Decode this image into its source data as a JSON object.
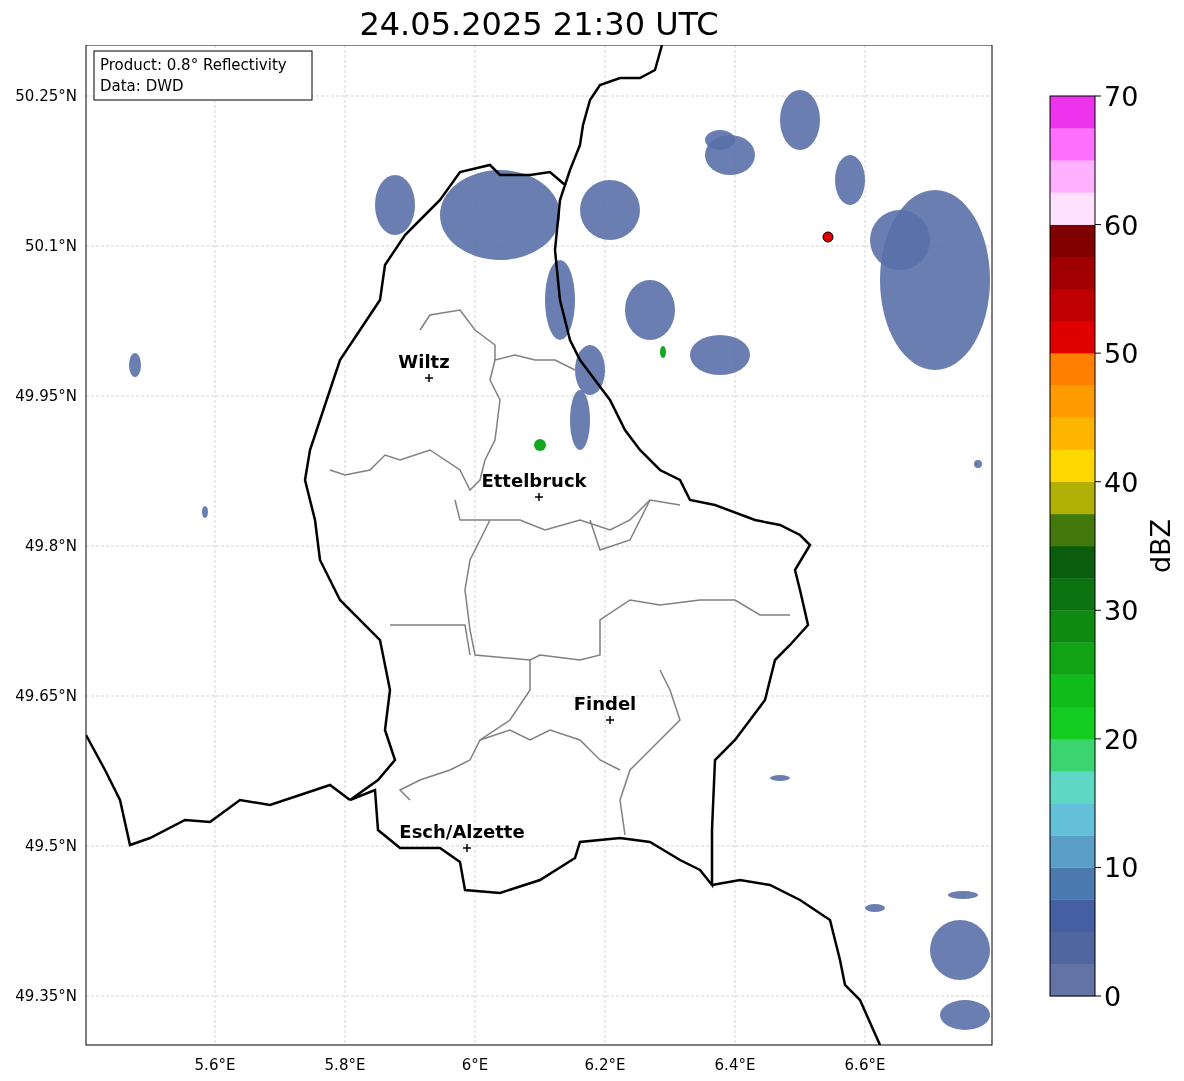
{
  "title": "24.05.2025 21:30 UTC",
  "map": {
    "info_box": [
      "Product: 0.8° Reflectivity",
      "Data: DWD"
    ],
    "lat_ticks": [
      "50.25°N",
      "50.1°N",
      "49.95°N",
      "49.8°N",
      "49.65°N",
      "49.5°N",
      "49.35°N"
    ],
    "lon_ticks": [
      "5.6°E",
      "5.8°E",
      "6°E",
      "6.2°E",
      "6.4°E",
      "6.6°E"
    ],
    "places": [
      {
        "name": "Wiltz"
      },
      {
        "name": "Ettelbruck"
      },
      {
        "name": "Findel"
      },
      {
        "name": "Esch/Alzette"
      }
    ]
  },
  "colorbar": {
    "label": "dBZ",
    "ticks": [
      "70",
      "60",
      "50",
      "40",
      "30",
      "20",
      "10",
      "0"
    ],
    "segments": [
      {
        "color": "#6473a5"
      },
      {
        "color": "#4f66a0"
      },
      {
        "color": "#4460a2"
      },
      {
        "color": "#4a7ab0"
      },
      {
        "color": "#5b9ec8"
      },
      {
        "color": "#63c0d8"
      },
      {
        "color": "#5ed8c4"
      },
      {
        "color": "#3cd46f"
      },
      {
        "color": "#13cc1f"
      },
      {
        "color": "#10bc1a"
      },
      {
        "color": "#10a414"
      },
      {
        "color": "#0e8a11"
      },
      {
        "color": "#0b7410"
      },
      {
        "color": "#0a5d0c"
      },
      {
        "color": "#45780c"
      },
      {
        "color": "#b0b007"
      },
      {
        "color": "#ffd700"
      },
      {
        "color": "#ffb400"
      },
      {
        "color": "#ff9a00"
      },
      {
        "color": "#ff7f00"
      },
      {
        "color": "#e00000"
      },
      {
        "color": "#c00000"
      },
      {
        "color": "#a00000"
      },
      {
        "color": "#800000"
      },
      {
        "color": "#ffe0ff"
      },
      {
        "color": "#ffb0ff"
      },
      {
        "color": "#ff70ff"
      },
      {
        "color": "#ee33ee"
      }
    ]
  }
}
